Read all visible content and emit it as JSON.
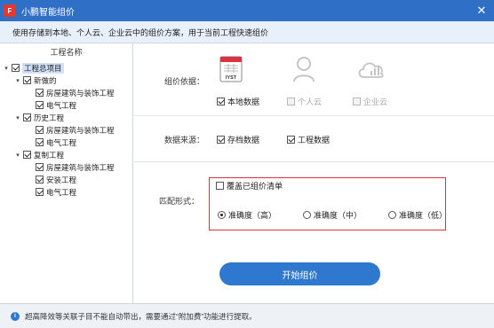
{
  "window": {
    "title": "小鹏智能组价",
    "logo_text": "F",
    "close_glyph": "✕"
  },
  "banner": {
    "text": "使用存储到本地、个人云、企业云中的组价方案，用于当前工程快速组价"
  },
  "tree": {
    "header": "工程名称",
    "nodes": [
      {
        "label": "工程总项目",
        "toggle": "▾",
        "checked": true
      },
      {
        "label": "新做的",
        "toggle": "▾",
        "checked": true
      },
      {
        "label": "房屋建筑与装饰工程",
        "toggle": "",
        "checked": true
      },
      {
        "label": "电气工程",
        "toggle": "",
        "checked": true
      },
      {
        "label": "历史工程",
        "toggle": "▾",
        "checked": true
      },
      {
        "label": "房屋建筑与装饰工程",
        "toggle": "",
        "checked": true
      },
      {
        "label": "电气工程",
        "toggle": "",
        "checked": true
      },
      {
        "label": "复制工程",
        "toggle": "▾",
        "checked": true
      },
      {
        "label": "房屋建筑与装饰工程",
        "toggle": "",
        "checked": true
      },
      {
        "label": "安装工程",
        "toggle": "",
        "checked": true
      },
      {
        "label": "电气工程",
        "toggle": "",
        "checked": true
      }
    ]
  },
  "basis": {
    "label": "组价依据：",
    "file_icon_text": "IYST",
    "options": [
      {
        "label": "本地数据",
        "checked": true,
        "enabled": true,
        "icon": "local-file-icon"
      },
      {
        "label": "个人云",
        "checked": false,
        "enabled": false,
        "icon": "person-icon"
      },
      {
        "label": "企业云",
        "checked": false,
        "enabled": false,
        "icon": "cloud-icon"
      }
    ]
  },
  "source": {
    "label": "数据来源：",
    "options": [
      {
        "label": "存档数据",
        "checked": true
      },
      {
        "label": "工程数据",
        "checked": true
      }
    ]
  },
  "match": {
    "label": "匹配形式：",
    "overwrite": {
      "label": "覆盖已组价清单",
      "checked": false
    },
    "options": [
      {
        "label": "准确度（高）",
        "checked": true
      },
      {
        "label": "准确度（中）",
        "checked": false
      },
      {
        "label": "准确度（低）",
        "checked": false
      }
    ]
  },
  "start_button": {
    "label": "开始组价"
  },
  "footer": {
    "info_glyph": "i",
    "text": "超高降效等关联子目不能自动带出，需要通过“附加费”功能进行提取。"
  },
  "colors": {
    "titlebar": "#2f6fc6",
    "accent": "#2f78cf",
    "highlight_box": "#d9333f",
    "banner_bg": "#e8f0fb"
  }
}
